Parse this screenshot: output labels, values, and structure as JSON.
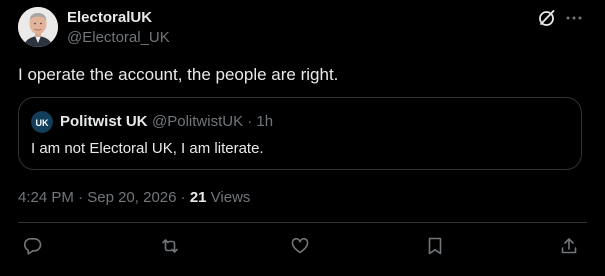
{
  "author": {
    "display_name": "ElectoralUK",
    "handle": "@Electoral_UK"
  },
  "tweet": {
    "text": "I operate the account, the people are right."
  },
  "quoted_tweet": {
    "display_name": "Politwist UK",
    "handle": "@PolitwistUK",
    "separator": "·",
    "time": "1h",
    "text": "I am not Electoral UK, I am literate.",
    "avatar_text": "UK"
  },
  "metadata": {
    "time": "4:24 PM",
    "date": "Sep 20, 2026",
    "separator": "·",
    "views_count": "21",
    "views_label": "Views"
  },
  "icons": {
    "top": [
      "grok-icon",
      "more-icon"
    ],
    "actions": [
      "reply-icon",
      "retweet-icon",
      "like-icon",
      "bookmark-icon",
      "share-icon"
    ]
  },
  "colors": {
    "background": "#000000",
    "text_primary": "#e7e9ea",
    "text_secondary": "#71767b",
    "border": "#2f3336",
    "quote_avatar": "#123e5c"
  }
}
